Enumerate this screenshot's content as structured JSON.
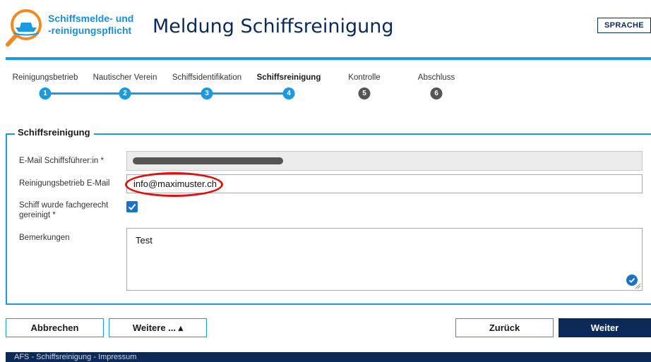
{
  "header": {
    "brand_line1": "Schiffsmelde- und",
    "brand_line2": "-reinigungspflicht",
    "title": "Meldung Schiffsreinigung",
    "language_button": "SPRACHE",
    "accent_color": "#1a9ae0",
    "navy_color": "#0b2a57"
  },
  "stepper": {
    "steps": [
      {
        "label": "Reinigungsbetrieb",
        "number": "1",
        "state": "done"
      },
      {
        "label": "Nautischer Verein",
        "number": "2",
        "state": "done"
      },
      {
        "label": "Schiffsidentifikation",
        "number": "3",
        "state": "done"
      },
      {
        "label": "Schiffsreinigung",
        "number": "4",
        "state": "current"
      },
      {
        "label": "Kontrolle",
        "number": "5",
        "state": "todo"
      },
      {
        "label": "Abschluss",
        "number": "6",
        "state": "todo"
      }
    ]
  },
  "form": {
    "section_title": "Schiffsreinigung",
    "email_captain_label": "E-Mail Schiffsführer:in *",
    "email_captain_value": "",
    "cleaning_company_email_label": "Reinigungsbetrieb E-Mail",
    "cleaning_company_email_value": "info@maximuster.ch",
    "cleaned_label": "Schiff wurde fachgerecht gereinigt *",
    "cleaned_checked": true,
    "remarks_label": "Bemerkungen",
    "remarks_value": "Test"
  },
  "buttons": {
    "cancel": "Abbrechen",
    "more": "Weitere ... ▴",
    "back": "Zurück",
    "next": "Weiter"
  },
  "footer": {
    "text": "AFS - Schiffsreinigung - Impressum"
  }
}
